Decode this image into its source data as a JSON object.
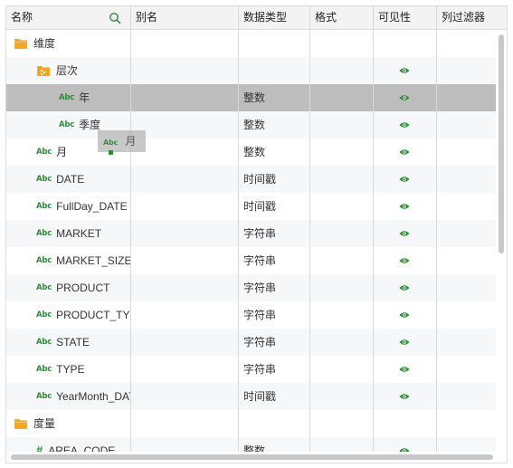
{
  "header": {
    "col_name": "名称",
    "col_alias": "别名",
    "col_datatype": "数据类型",
    "col_format": "格式",
    "col_visibility": "可见性",
    "col_filter": "列过滤器"
  },
  "rows": [
    {
      "name": "维度",
      "icon": "folder-icon",
      "indent": 0,
      "datatype": "",
      "visible": false
    },
    {
      "name": "层次",
      "icon": "hierarchy-folder-icon",
      "indent": 1,
      "datatype": "",
      "visible": true
    },
    {
      "name": "年",
      "icon": "abc-icon",
      "indent": 2,
      "datatype": "整数",
      "visible": true,
      "selected": true
    },
    {
      "name": "季度",
      "icon": "abc-icon",
      "indent": 2,
      "datatype": "整数",
      "visible": true
    },
    {
      "name": "月",
      "icon": "abc-icon",
      "indent": 1,
      "datatype": "整数",
      "visible": true
    },
    {
      "name": "DATE",
      "icon": "abc-icon",
      "indent": 1,
      "datatype": "时间戳",
      "visible": true
    },
    {
      "name": "FullDay_DATE",
      "icon": "abc-icon",
      "indent": 1,
      "datatype": "时间戳",
      "visible": true
    },
    {
      "name": "MARKET",
      "icon": "abc-icon",
      "indent": 1,
      "datatype": "字符串",
      "visible": true
    },
    {
      "name": "MARKET_SIZE",
      "icon": "abc-icon",
      "indent": 1,
      "datatype": "字符串",
      "visible": true
    },
    {
      "name": "PRODUCT",
      "icon": "abc-icon",
      "indent": 1,
      "datatype": "字符串",
      "visible": true
    },
    {
      "name": "PRODUCT_TYPE",
      "icon": "abc-icon",
      "indent": 1,
      "datatype": "字符串",
      "visible": true
    },
    {
      "name": "STATE",
      "icon": "abc-icon",
      "indent": 1,
      "datatype": "字符串",
      "visible": true
    },
    {
      "name": "TYPE",
      "icon": "abc-icon",
      "indent": 1,
      "datatype": "字符串",
      "visible": true
    },
    {
      "name": "YearMonth_DATE",
      "icon": "abc-icon",
      "indent": 1,
      "datatype": "时间戳",
      "visible": true
    },
    {
      "name": "度量",
      "icon": "folder-icon",
      "indent": 0,
      "datatype": "",
      "visible": false
    },
    {
      "name": "AREA_CODE",
      "icon": "hash-icon",
      "indent": 1,
      "datatype": "整数",
      "visible": true
    }
  ],
  "abc_label": "Abc",
  "hash_label": "#",
  "drag_ghost": {
    "label": "月"
  },
  "colors": {
    "folder": "#f5a623",
    "accent_green": "#2e8b3a",
    "selected_row": "#bdbdbd",
    "header_bg": "#f3f3f3"
  }
}
